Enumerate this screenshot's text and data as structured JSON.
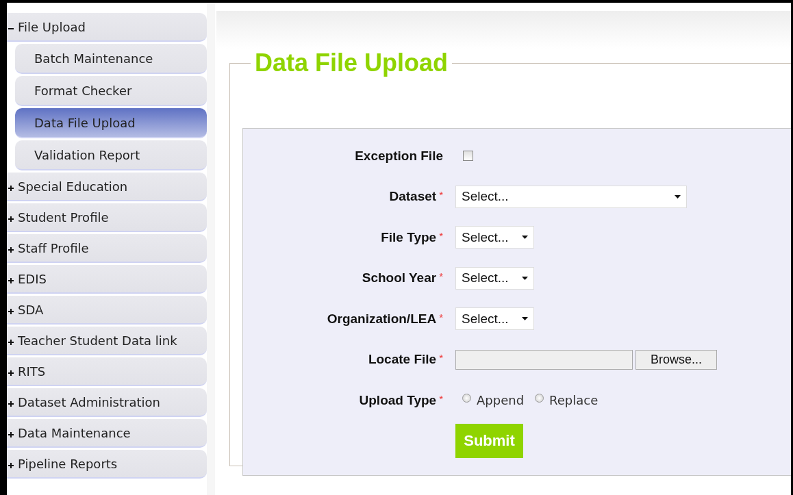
{
  "sidebar": {
    "items": [
      {
        "label": "File Upload",
        "expanded": true,
        "children": [
          {
            "label": "Batch Maintenance",
            "selected": false
          },
          {
            "label": "Format Checker",
            "selected": false
          },
          {
            "label": "Data File Upload",
            "selected": true
          },
          {
            "label": "Validation Report",
            "selected": false
          }
        ]
      },
      {
        "label": "Special Education",
        "expanded": false
      },
      {
        "label": "Student Profile",
        "expanded": false
      },
      {
        "label": "Staff Profile",
        "expanded": false
      },
      {
        "label": "EDIS",
        "expanded": false
      },
      {
        "label": "SDA",
        "expanded": false
      },
      {
        "label": "Teacher Student Data link",
        "expanded": false
      },
      {
        "label": "RITS",
        "expanded": false
      },
      {
        "label": "Dataset Administration",
        "expanded": false
      },
      {
        "label": "Data Maintenance",
        "expanded": false
      },
      {
        "label": "Pipeline Reports",
        "expanded": false
      }
    ]
  },
  "page": {
    "title": "Data File Upload"
  },
  "form": {
    "fields": [
      {
        "kind": "checkbox",
        "label": "Exception File",
        "checked": false
      },
      {
        "kind": "dropdown",
        "label": "Dataset",
        "marker": "*",
        "value": "Select...",
        "wide": true
      },
      {
        "kind": "dropdown",
        "label": "File Type",
        "marker": "*",
        "value": "Select...",
        "wide": false
      },
      {
        "kind": "dropdown",
        "label": "School Year",
        "marker": "*",
        "value": "Select...",
        "wide": false
      },
      {
        "kind": "dropdown",
        "label": "Organization/LEA",
        "marker": "*",
        "value": "Select...",
        "wide": false
      },
      {
        "kind": "file",
        "label": "Locate File",
        "marker": "*",
        "button": "Browse..."
      },
      {
        "kind": "radio",
        "label": "Upload Type",
        "marker": "*",
        "options": [
          {
            "label": "Append",
            "selected": false
          },
          {
            "label": "Replace",
            "selected": false
          }
        ]
      }
    ],
    "submit": "Submit"
  }
}
